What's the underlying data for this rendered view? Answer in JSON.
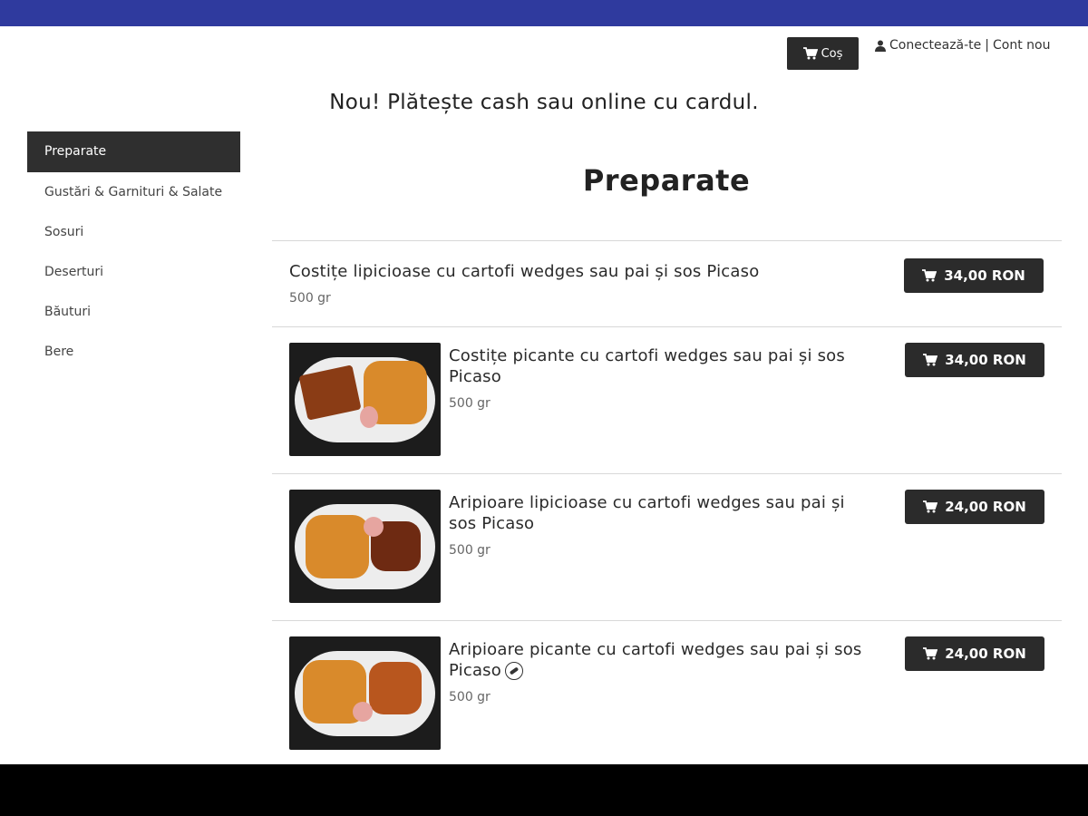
{
  "header": {
    "cart_label": "Coș",
    "login_label": "Conectează-te",
    "separator": "|",
    "register_label": "Cont nou"
  },
  "promo_text": "Nou! Plătește cash sau online cu cardul.",
  "sidebar": {
    "items": [
      {
        "label": "Preparate"
      },
      {
        "label": "Gustări & Garnituri & Salate"
      },
      {
        "label": "Sosuri"
      },
      {
        "label": "Deserturi"
      },
      {
        "label": "Băuturi"
      },
      {
        "label": "Bere"
      }
    ]
  },
  "section_title": "Preparate",
  "menu": {
    "items": [
      {
        "name": "Costițe lipicioase cu cartofi wedges sau pai și sos Picaso",
        "weight": "500 gr",
        "price": "34,00 RON"
      },
      {
        "name": "Costițe picante cu cartofi wedges sau pai și sos Picaso",
        "weight": "500 gr",
        "price": "34,00 RON"
      },
      {
        "name": "Aripioare lipicioase cu cartofi wedges sau pai și sos Picaso",
        "weight": "500 gr",
        "price": "24,00 RON"
      },
      {
        "name": "Aripioare picante cu cartofi wedges sau pai și sos Picaso",
        "weight": "500 gr",
        "price": "24,00 RON"
      }
    ]
  },
  "colors": {
    "topbar": "#2f3a9e",
    "dark_button": "#2b2b2b"
  },
  "icons": {
    "cart": "shopping-cart-icon",
    "user": "user-icon",
    "spicy": "chili-pepper-icon"
  }
}
